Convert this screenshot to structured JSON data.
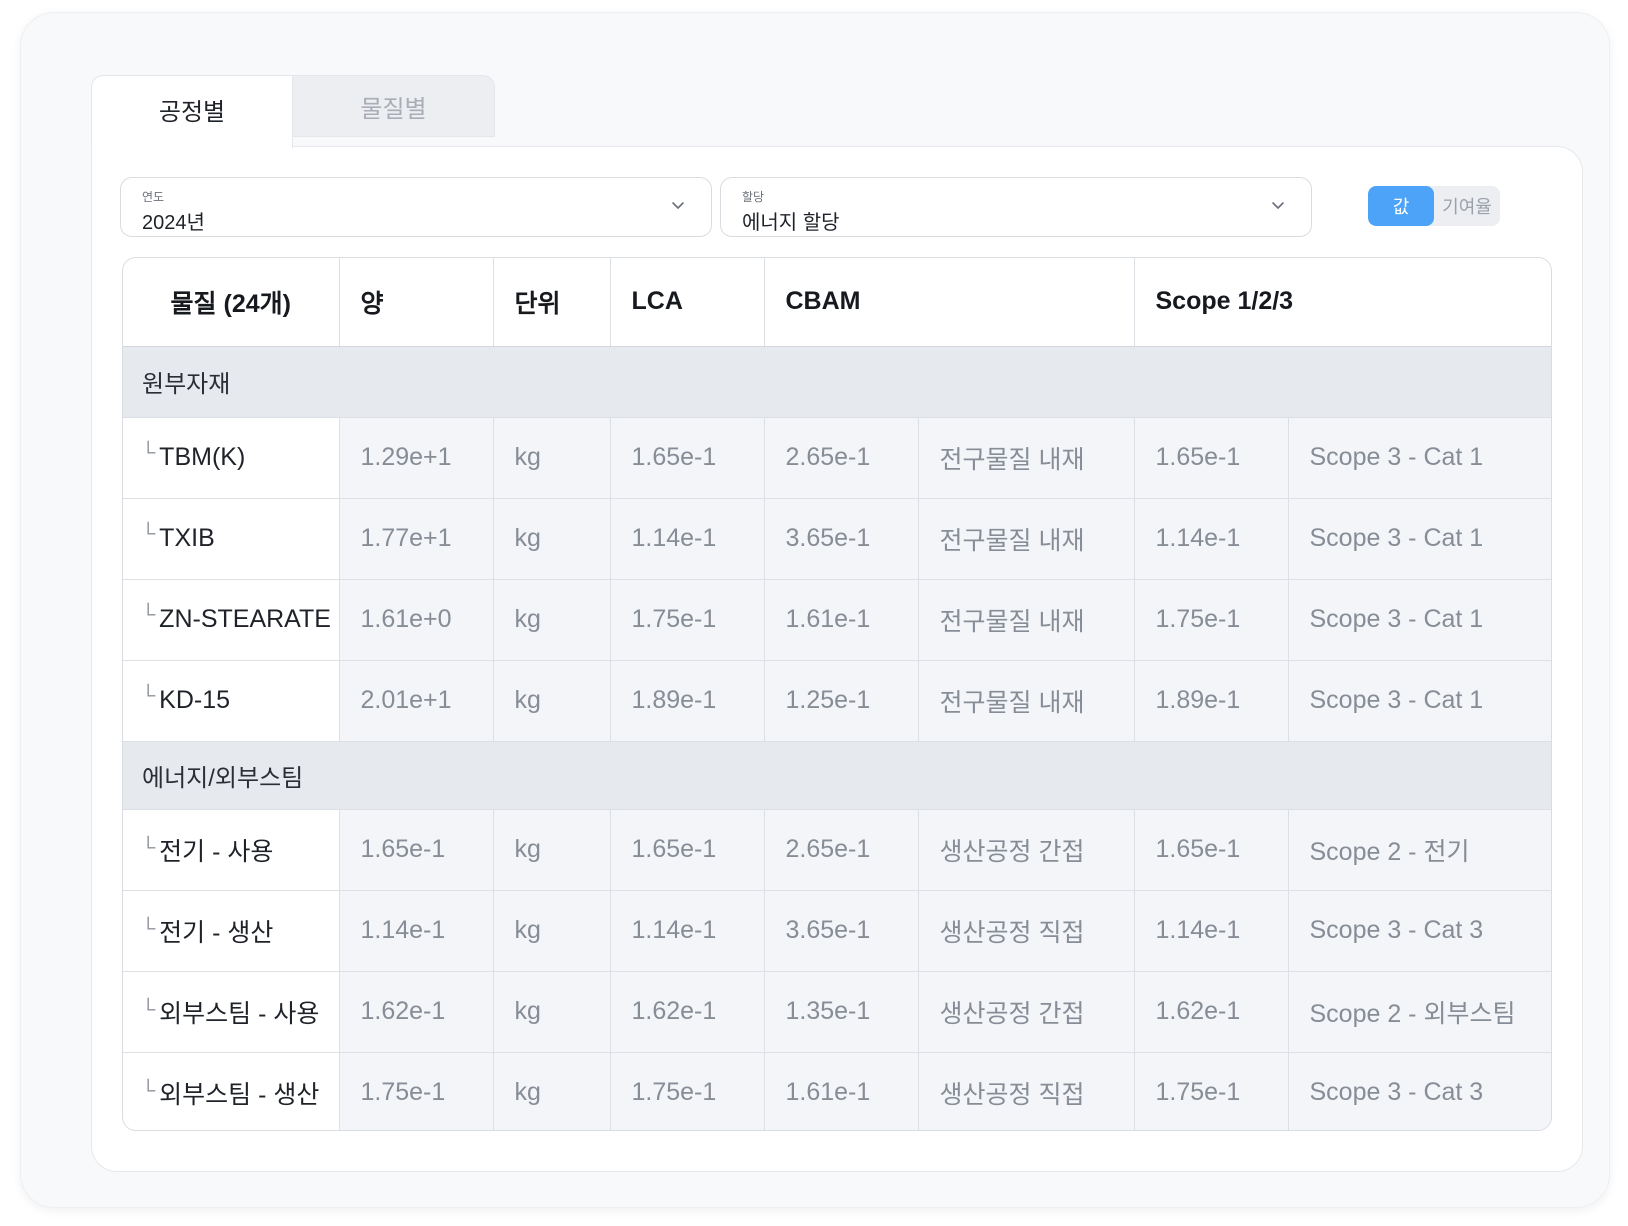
{
  "tabs": [
    {
      "label": "공정별",
      "active": true
    },
    {
      "label": "물질별",
      "active": false
    }
  ],
  "filters": {
    "year": {
      "label": "연도",
      "value": "2024년"
    },
    "allocation": {
      "label": "할당",
      "value": "에너지 할당"
    }
  },
  "toggle": {
    "value_label": "값",
    "ratio_label": "기여율",
    "selected": "값"
  },
  "colors": {
    "accent": "#4da3f7",
    "group_bg": "#e6e9ee"
  },
  "table": {
    "headers": {
      "material": "물질 (24개)",
      "amount": "양",
      "unit": "단위",
      "lca": "LCA",
      "cbam": "CBAM",
      "scope": "Scope 1/2/3"
    },
    "groups": [
      {
        "name": "원부자재",
        "rows": [
          {
            "name": "TBM(K)",
            "amount": "1.29e+1",
            "unit": "kg",
            "lca": "1.65e-1",
            "cbam": "2.65e-1",
            "cbam_type": "전구물질 내재",
            "scope": "1.65e-1",
            "scope_cat": "Scope 3 - Cat 1"
          },
          {
            "name": "TXIB",
            "amount": "1.77e+1",
            "unit": "kg",
            "lca": "1.14e-1",
            "cbam": "3.65e-1",
            "cbam_type": "전구물질 내재",
            "scope": "1.14e-1",
            "scope_cat": "Scope 3 - Cat 1"
          },
          {
            "name": "ZN-STEARATE",
            "amount": "1.61e+0",
            "unit": "kg",
            "lca": "1.75e-1",
            "cbam": "1.61e-1",
            "cbam_type": "전구물질 내재",
            "scope": "1.75e-1",
            "scope_cat": "Scope 3 - Cat 1"
          },
          {
            "name": "KD-15",
            "amount": "2.01e+1",
            "unit": "kg",
            "lca": "1.89e-1",
            "cbam": "1.25e-1",
            "cbam_type": "전구물질 내재",
            "scope": "1.89e-1",
            "scope_cat": "Scope 3 - Cat 1"
          }
        ]
      },
      {
        "name": "에너지/외부스팀",
        "rows": [
          {
            "name": "전기 - 사용",
            "amount": "1.65e-1",
            "unit": "kg",
            "lca": "1.65e-1",
            "cbam": "2.65e-1",
            "cbam_type": "생산공정 간접",
            "scope": "1.65e-1",
            "scope_cat": "Scope 2 - 전기"
          },
          {
            "name": "전기 - 생산",
            "amount": "1.14e-1",
            "unit": "kg",
            "lca": "1.14e-1",
            "cbam": "3.65e-1",
            "cbam_type": "생산공정 직접",
            "scope": "1.14e-1",
            "scope_cat": "Scope 3 - Cat 3"
          },
          {
            "name": "외부스팀 - 사용",
            "amount": "1.62e-1",
            "unit": "kg",
            "lca": "1.62e-1",
            "cbam": "1.35e-1",
            "cbam_type": "생산공정 간접",
            "scope": "1.62e-1",
            "scope_cat": "Scope 2 - 외부스팀"
          },
          {
            "name": "외부스팀 - 생산",
            "amount": "1.75e-1",
            "unit": "kg",
            "lca": "1.75e-1",
            "cbam": "1.61e-1",
            "cbam_type": "생산공정 직접",
            "scope": "1.75e-1",
            "scope_cat": "Scope 3 - Cat 3"
          }
        ]
      }
    ]
  }
}
